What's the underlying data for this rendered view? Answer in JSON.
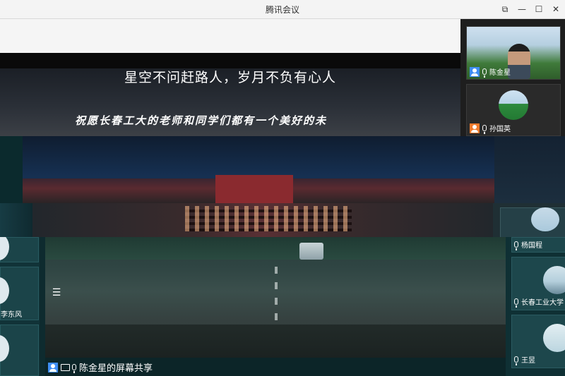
{
  "window": {
    "title": "腾讯会议",
    "controls": {
      "restore": "⧉",
      "minimize": "—",
      "maximize": "☐",
      "close": "✕"
    }
  },
  "slide": {
    "title": "星空不问赶路人，岁月不负有心人",
    "subtitle": "祝愿长春工大的老师和同学们都有一个美好的未"
  },
  "participants": [
    {
      "name": "陈金星"
    },
    {
      "name": "孙国英"
    },
    {
      "name": "李东风"
    },
    {
      "name": "杨国程"
    },
    {
      "name": "长春工业大学"
    },
    {
      "name": "王昱"
    }
  ],
  "share": {
    "label": "陈金星的屏幕共享"
  },
  "icons": {
    "menu": "☰"
  },
  "colors": {
    "user_blue": "#3f8ef5",
    "user_orange": "#f07a2c",
    "titlebar_bg": "#f4f4f4"
  }
}
